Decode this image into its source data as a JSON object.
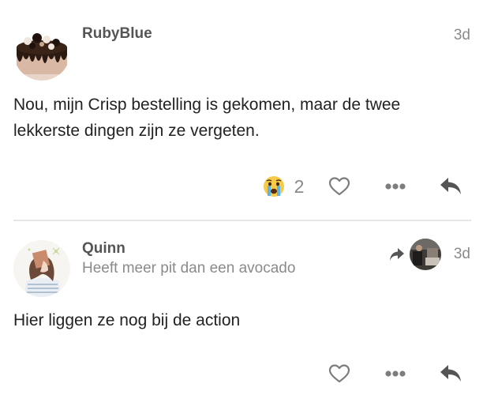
{
  "posts": [
    {
      "username": "RubyBlue",
      "date": "3d",
      "body": "Nou, mijn Crisp bestelling is gekomen, maar de twee lekkerste dingen zijn ze vergeten.",
      "avatar_icon": "cake-avatar",
      "reaction": {
        "emoji_icon": "crying-face-icon",
        "count": "2"
      },
      "actions": [
        "heart-icon",
        "more-icon",
        "reply-icon"
      ]
    },
    {
      "username": "Quinn",
      "user_title": "Heeft meer pit dan een avocado",
      "date": "3d",
      "body": "Hier liggen ze nog bij de action",
      "avatar_icon": "drawing-avatar",
      "reply_to_icon": "reply-to-avatar",
      "actions": [
        "heart-icon",
        "more-icon",
        "reply-icon"
      ]
    }
  ],
  "colors": {
    "text": "#222222",
    "muted": "#8a8a8a",
    "icon": "#555555",
    "divider": "#e6e6e6"
  }
}
